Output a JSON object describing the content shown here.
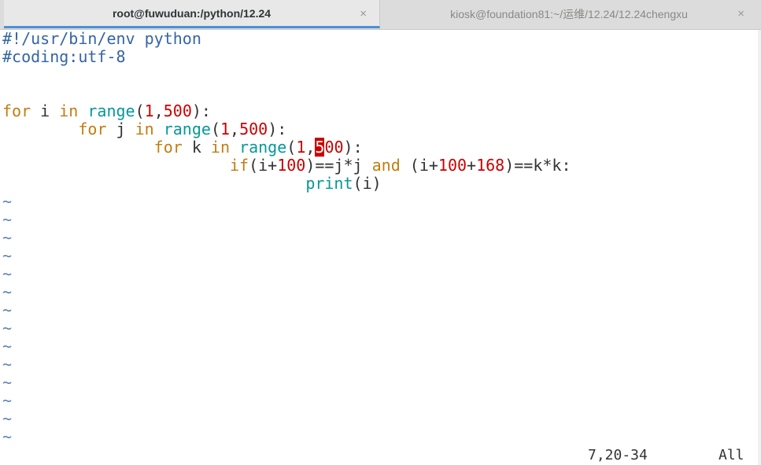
{
  "tabs": [
    {
      "label": "root@fuwuduan:/python/12.24",
      "active": true,
      "close": "×"
    },
    {
      "label": "kiosk@foundation81:~/运维/12.24/12.24chengxu",
      "active": false,
      "close": "×"
    }
  ],
  "code_lines": [
    [
      {
        "t": "#!/usr/bin/env python",
        "c": "comment"
      }
    ],
    [
      {
        "t": "#coding:utf-8",
        "c": "comment"
      }
    ],
    [],
    [],
    [
      {
        "t": "for",
        "c": "kw"
      },
      {
        "t": " i ",
        "c": "text"
      },
      {
        "t": "in",
        "c": "kw"
      },
      {
        "t": " ",
        "c": "text"
      },
      {
        "t": "range",
        "c": "builtin"
      },
      {
        "t": "(",
        "c": "text"
      },
      {
        "t": "1",
        "c": "num"
      },
      {
        "t": ",",
        "c": "text"
      },
      {
        "t": "500",
        "c": "num"
      },
      {
        "t": "):",
        "c": "text"
      }
    ],
    [
      {
        "t": "        ",
        "c": "text"
      },
      {
        "t": "for",
        "c": "kw"
      },
      {
        "t": " j ",
        "c": "text"
      },
      {
        "t": "in",
        "c": "kw"
      },
      {
        "t": " ",
        "c": "text"
      },
      {
        "t": "range",
        "c": "builtin"
      },
      {
        "t": "(",
        "c": "text"
      },
      {
        "t": "1",
        "c": "num"
      },
      {
        "t": ",",
        "c": "text"
      },
      {
        "t": "500",
        "c": "num"
      },
      {
        "t": "):",
        "c": "text"
      }
    ],
    [
      {
        "t": "                ",
        "c": "text"
      },
      {
        "t": "for",
        "c": "kw"
      },
      {
        "t": " k ",
        "c": "text"
      },
      {
        "t": "in",
        "c": "kw"
      },
      {
        "t": " ",
        "c": "text"
      },
      {
        "t": "range",
        "c": "builtin"
      },
      {
        "t": "(",
        "c": "text"
      },
      {
        "t": "1",
        "c": "num"
      },
      {
        "t": ",",
        "c": "text"
      },
      {
        "t": "5",
        "c": "cursor"
      },
      {
        "t": "00",
        "c": "num"
      },
      {
        "t": "):",
        "c": "text"
      }
    ],
    [
      {
        "t": "                        ",
        "c": "text"
      },
      {
        "t": "if",
        "c": "kw"
      },
      {
        "t": "(i+",
        "c": "text"
      },
      {
        "t": "100",
        "c": "num"
      },
      {
        "t": ")==j*j ",
        "c": "text"
      },
      {
        "t": "and",
        "c": "kw"
      },
      {
        "t": " (i+",
        "c": "text"
      },
      {
        "t": "100",
        "c": "num"
      },
      {
        "t": "+",
        "c": "text"
      },
      {
        "t": "168",
        "c": "num"
      },
      {
        "t": ")==k*k:",
        "c": "text"
      }
    ],
    [
      {
        "t": "                                ",
        "c": "text"
      },
      {
        "t": "print",
        "c": "builtin"
      },
      {
        "t": "(i)",
        "c": "text"
      }
    ]
  ],
  "empty_line_marker": "~",
  "empty_line_count": 14,
  "status": {
    "position": "7,20-34",
    "scroll": "All"
  }
}
